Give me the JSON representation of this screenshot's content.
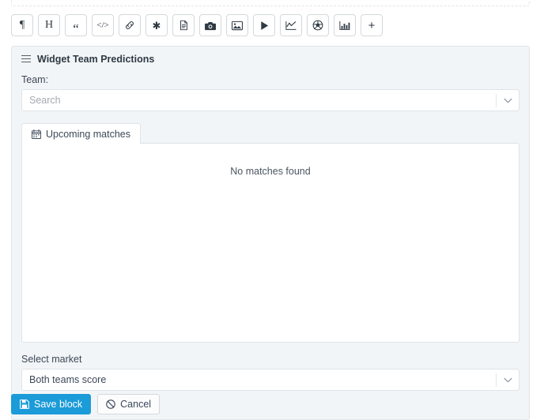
{
  "toolbar": {
    "buttons": [
      {
        "name": "paragraph-icon",
        "label": "Paragraph",
        "glyph": "¶"
      },
      {
        "name": "heading-icon",
        "label": "Heading",
        "glyph": "H"
      },
      {
        "name": "quote-icon",
        "label": "Quote",
        "glyph": "“"
      },
      {
        "name": "code-icon",
        "label": "Code",
        "glyph": "</>"
      },
      {
        "name": "link-icon",
        "label": "Link",
        "glyph": "℘"
      },
      {
        "name": "asterisk-icon",
        "label": "Separator",
        "glyph": "✱"
      },
      {
        "name": "file-icon",
        "label": "File",
        "glyph": ""
      },
      {
        "name": "camera-icon",
        "label": "Camera",
        "glyph": ""
      },
      {
        "name": "image-icon",
        "label": "Image",
        "glyph": ""
      },
      {
        "name": "video-icon",
        "label": "Video",
        "glyph": ""
      },
      {
        "name": "chart-line-icon",
        "label": "Line chart",
        "glyph": ""
      },
      {
        "name": "soccer-ball-icon",
        "label": "Match widget",
        "glyph": ""
      },
      {
        "name": "chart-bar-icon",
        "label": "Bar chart",
        "glyph": ""
      },
      {
        "name": "plus-icon",
        "label": "Add block",
        "glyph": "+"
      }
    ]
  },
  "widget": {
    "title": "Widget Team Predictions",
    "team": {
      "label": "Team:",
      "placeholder": "Search",
      "value": ""
    },
    "tabs": [
      {
        "label": "Upcoming matches",
        "icon": "calendar-icon",
        "active": true
      }
    ],
    "tab_content": {
      "empty_message": "No matches found"
    },
    "market": {
      "label": "Select market",
      "value": "Both teams score"
    }
  },
  "actions": {
    "save_label": "Save block",
    "cancel_label": "Cancel"
  },
  "colors": {
    "primary": "#1b9bd8",
    "panel_bg": "#f2f5f7",
    "border": "#dfe3e7",
    "text": "#3c4858",
    "placeholder": "#a3aab1"
  }
}
